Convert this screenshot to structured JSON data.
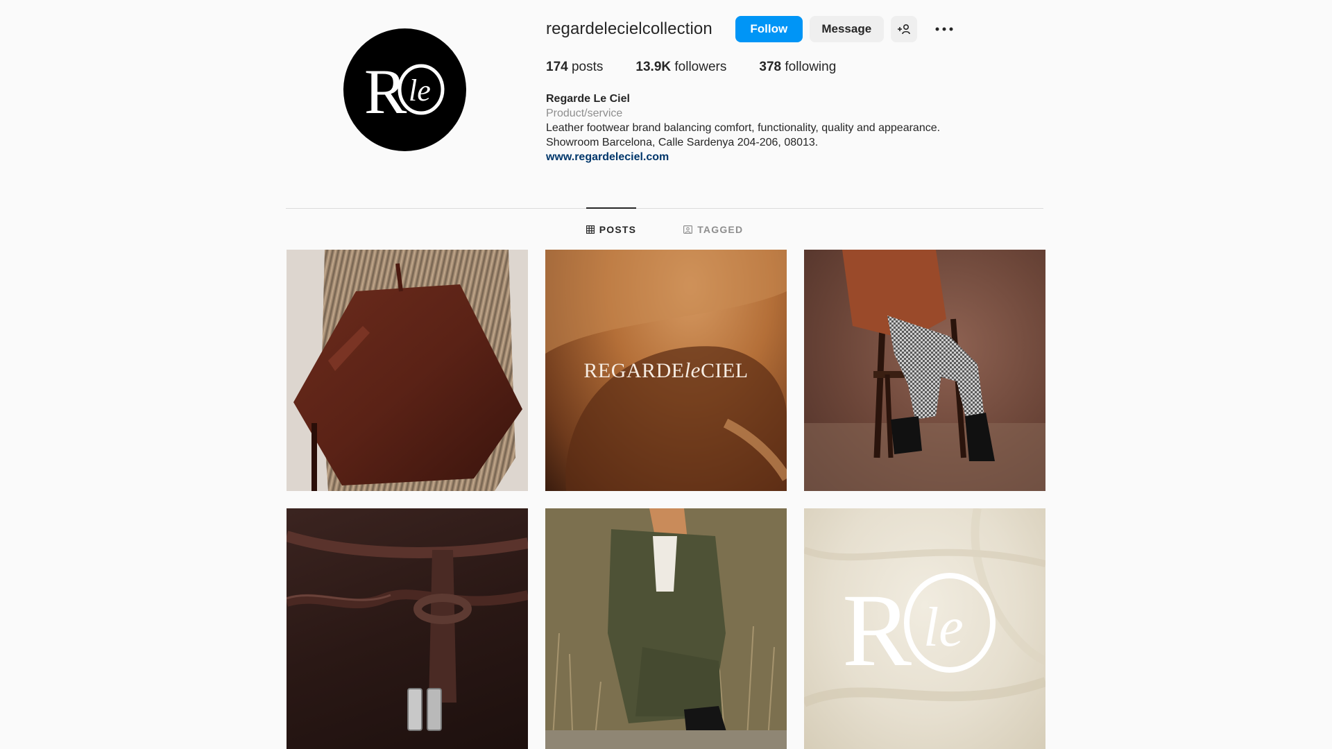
{
  "profile": {
    "username": "regardelecielcollection",
    "follow_label": "Follow",
    "message_label": "Message",
    "avatar_logo": {
      "letter": "R",
      "overlay": "le"
    }
  },
  "stats": [
    {
      "value": "174",
      "label": "posts"
    },
    {
      "value": "13.9K",
      "label": "followers"
    },
    {
      "value": "378",
      "label": "following"
    }
  ],
  "bio": {
    "name": "Regarde Le Ciel",
    "category": "Product/service",
    "line1": "Leather footwear brand balancing comfort, functionality, quality and appearance.",
    "line2": "Showroom Barcelona, Calle Sardenya 204-206, 08013.",
    "link": "www.regardeleciel.com"
  },
  "tabs": [
    {
      "label": "POSTS",
      "icon": "grid-icon",
      "active": true
    },
    {
      "label": "TAGGED",
      "icon": "tag-icon",
      "active": false
    }
  ],
  "posts": [
    {
      "subject": "brown leather tote on striped shirt"
    },
    {
      "subject": "leather close-up with brand wordmark",
      "wordmark_a": "REGARDE",
      "wordmark_b": "le",
      "wordmark_c": "CIEL"
    },
    {
      "subject": "woman seated on wooden chair wearing boots"
    },
    {
      "subject": "dark leather knotted strap detail"
    },
    {
      "subject": "woman in green suit sitting in field"
    },
    {
      "subject": "logo on cream linen",
      "logo_letter": "R",
      "logo_overlay": "le"
    }
  ],
  "colors": {
    "accent": "#0095f6",
    "link": "#00376b",
    "muted": "#8e8e8e",
    "button_gray": "#efefef"
  }
}
